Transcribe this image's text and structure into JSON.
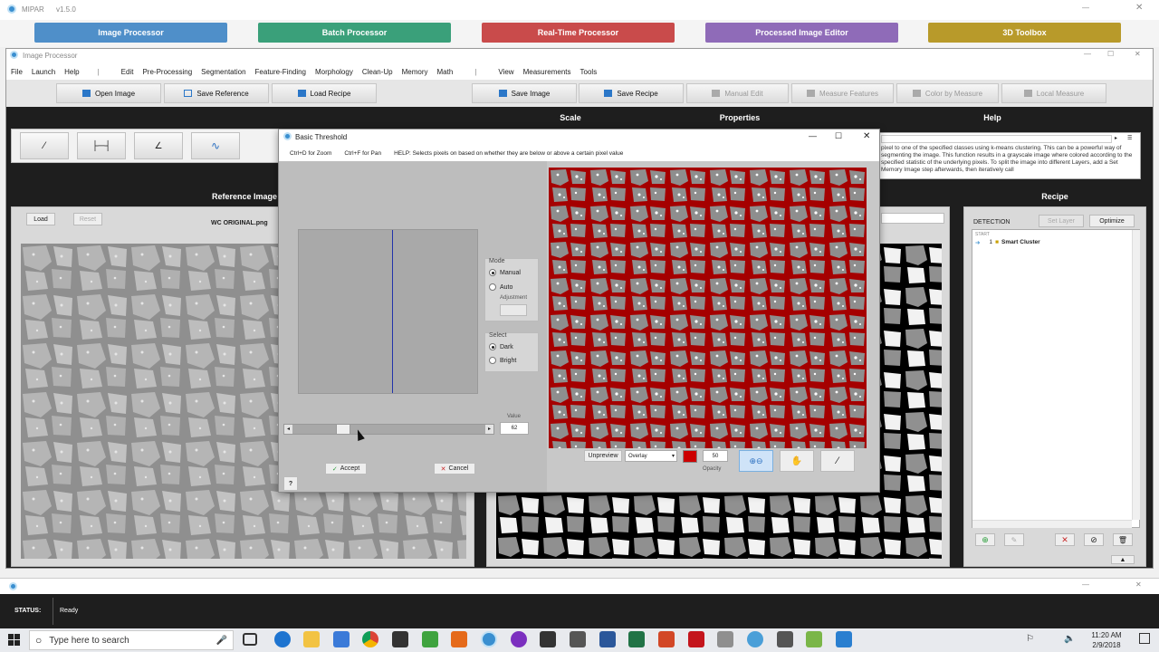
{
  "app": {
    "title": "MIPAR",
    "version": "v1.5.0"
  },
  "modules": [
    {
      "label": "Image Processor",
      "color": "#4f8fc9"
    },
    {
      "label": "Batch Processor",
      "color": "#3aa07a"
    },
    {
      "label": "Real-Time Processor",
      "color": "#c94b4b"
    },
    {
      "label": "Processed Image Editor",
      "color": "#8f6bb8"
    },
    {
      "label": "3D Toolbox",
      "color": "#b89a2a"
    }
  ],
  "sub_window": {
    "title": "Image Processor"
  },
  "menu": [
    "File",
    "Launch",
    "Help",
    "Edit",
    "Pre-Processing",
    "Segmentation",
    "Feature-Finding",
    "Morphology",
    "Clean-Up",
    "Memory",
    "Math",
    "View",
    "Measurements",
    "Tools"
  ],
  "toolbar": {
    "open_image": "Open Image",
    "save_reference": "Save Reference",
    "load_recipe": "Load Recipe",
    "save_image": "Save Image",
    "save_recipe": "Save Recipe",
    "manual_edit": "Manual Edit",
    "measure_features": "Measure Features",
    "color_by_measure": "Color by Measure",
    "local_measure": "Local Measure"
  },
  "sections": {
    "scale": "Scale",
    "properties": "Properties",
    "help": "Help",
    "reference_image": "Reference Image",
    "recipe": "Recipe"
  },
  "help_text": "pixel to one of the specified classes using k-means clustering. This can be a powerful way of segmenting the image. This function results in a grayscale image where colored according to the specified statistic of the underlying pixels. To split the image into different Layers, add a Set Memory Image step afterwards, then iteratively call",
  "reference": {
    "load": "Load",
    "reset": "Reset",
    "filename": "WC ORIGINAL.png"
  },
  "recipe": {
    "detection": "DETECTION",
    "set_layer": "Set Layer",
    "optimize": "Optimize",
    "start": "START",
    "step_num": "1",
    "step_name": "Smart Cluster"
  },
  "status": {
    "label": "STATUS:",
    "value": "Ready"
  },
  "dialog": {
    "title": "Basic Threshold",
    "hint_zoom": "Ctrl+D for Zoom",
    "hint_pan": "Ctrl+F for Pan",
    "help": "HELP: Selects pixels on based on whether they are below or above a certain pixel value",
    "mode_label": "Mode",
    "manual": "Manual",
    "auto": "Auto",
    "adjustment": "Adjustment",
    "select_label": "Select",
    "dark": "Dark",
    "bright": "Bright",
    "value_label": "Value",
    "value": "62",
    "slider_fraction": 0.24,
    "accept": "Accept",
    "cancel": "Cancel",
    "help_btn": "?",
    "unpreview": "Unpreview",
    "overlay_mode": "Overlay",
    "overlay_color": "#cc0000",
    "opacity_label": "Opacity",
    "opacity": "50"
  },
  "taskbar": {
    "search_placeholder": "Type here to search",
    "time": "11:20 AM",
    "date": "2/9/2018"
  }
}
